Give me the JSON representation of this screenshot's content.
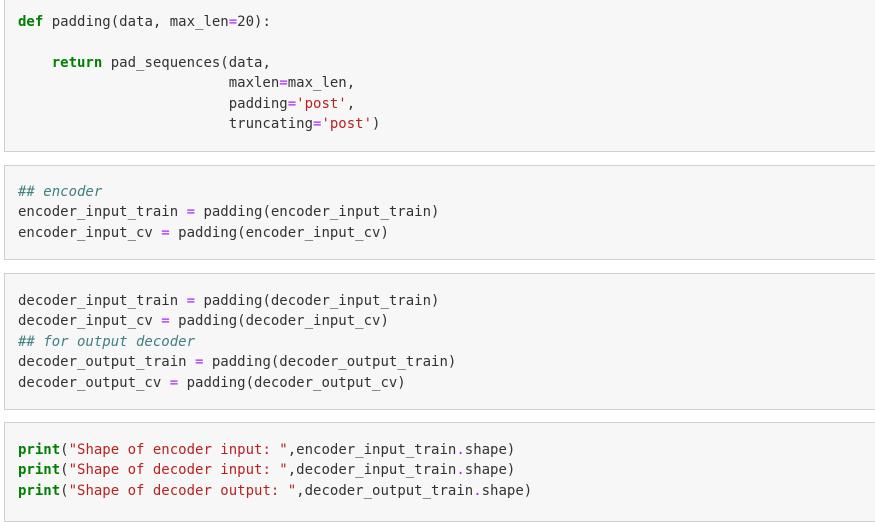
{
  "cells": [
    {
      "lines": [
        [
          {
            "t": "def",
            "c": "kw"
          },
          {
            "t": " padding(data, max_len"
          },
          {
            "t": "=",
            "c": "op"
          },
          {
            "t": "20):"
          }
        ],
        [],
        [
          {
            "t": "    "
          },
          {
            "t": "return",
            "c": "kw"
          },
          {
            "t": " pad_sequences(data,"
          }
        ],
        [
          {
            "t": "                         maxlen"
          },
          {
            "t": "=",
            "c": "op"
          },
          {
            "t": "max_len,"
          }
        ],
        [
          {
            "t": "                         padding"
          },
          {
            "t": "=",
            "c": "op"
          },
          {
            "t": "'post'",
            "c": "str"
          },
          {
            "t": ","
          }
        ],
        [
          {
            "t": "                         truncating"
          },
          {
            "t": "=",
            "c": "op"
          },
          {
            "t": "'post'",
            "c": "str"
          },
          {
            "t": ")"
          }
        ]
      ]
    },
    {
      "lines": [
        [
          {
            "t": "## encoder",
            "c": "cm"
          }
        ],
        [
          {
            "t": "encoder_input_train "
          },
          {
            "t": "=",
            "c": "op"
          },
          {
            "t": " padding(encoder_input_train)"
          }
        ],
        [
          {
            "t": "encoder_input_cv "
          },
          {
            "t": "=",
            "c": "op"
          },
          {
            "t": " padding(encoder_input_cv)"
          }
        ]
      ]
    },
    {
      "lines": [
        [
          {
            "t": "decoder_input_train "
          },
          {
            "t": "=",
            "c": "op"
          },
          {
            "t": " padding(decoder_input_train)"
          }
        ],
        [
          {
            "t": "decoder_input_cv "
          },
          {
            "t": "=",
            "c": "op"
          },
          {
            "t": " padding(decoder_input_cv)"
          }
        ],
        [
          {
            "t": "## for output decoder",
            "c": "cm"
          }
        ],
        [
          {
            "t": "decoder_output_train "
          },
          {
            "t": "=",
            "c": "op"
          },
          {
            "t": " padding(decoder_output_train)"
          }
        ],
        [
          {
            "t": "decoder_output_cv "
          },
          {
            "t": "=",
            "c": "op"
          },
          {
            "t": " padding(decoder_output_cv)"
          }
        ]
      ]
    },
    {
      "lines": [
        [
          {
            "t": "print",
            "c": "kw"
          },
          {
            "t": "("
          },
          {
            "t": "\"Shape of encoder input: \"",
            "c": "str"
          },
          {
            "t": ",encoder_input_train"
          },
          {
            "t": ".",
            "c": "op"
          },
          {
            "t": "shape)"
          }
        ],
        [
          {
            "t": "print",
            "c": "kw"
          },
          {
            "t": "("
          },
          {
            "t": "\"Shape of decoder input: \"",
            "c": "str"
          },
          {
            "t": ",decoder_input_train"
          },
          {
            "t": ".",
            "c": "op"
          },
          {
            "t": "shape)"
          }
        ],
        [
          {
            "t": "print",
            "c": "kw"
          },
          {
            "t": "("
          },
          {
            "t": "\"Shape of decoder output: \"",
            "c": "str"
          },
          {
            "t": ",decoder_output_train"
          },
          {
            "t": ".",
            "c": "op"
          },
          {
            "t": "shape)"
          }
        ]
      ]
    }
  ]
}
